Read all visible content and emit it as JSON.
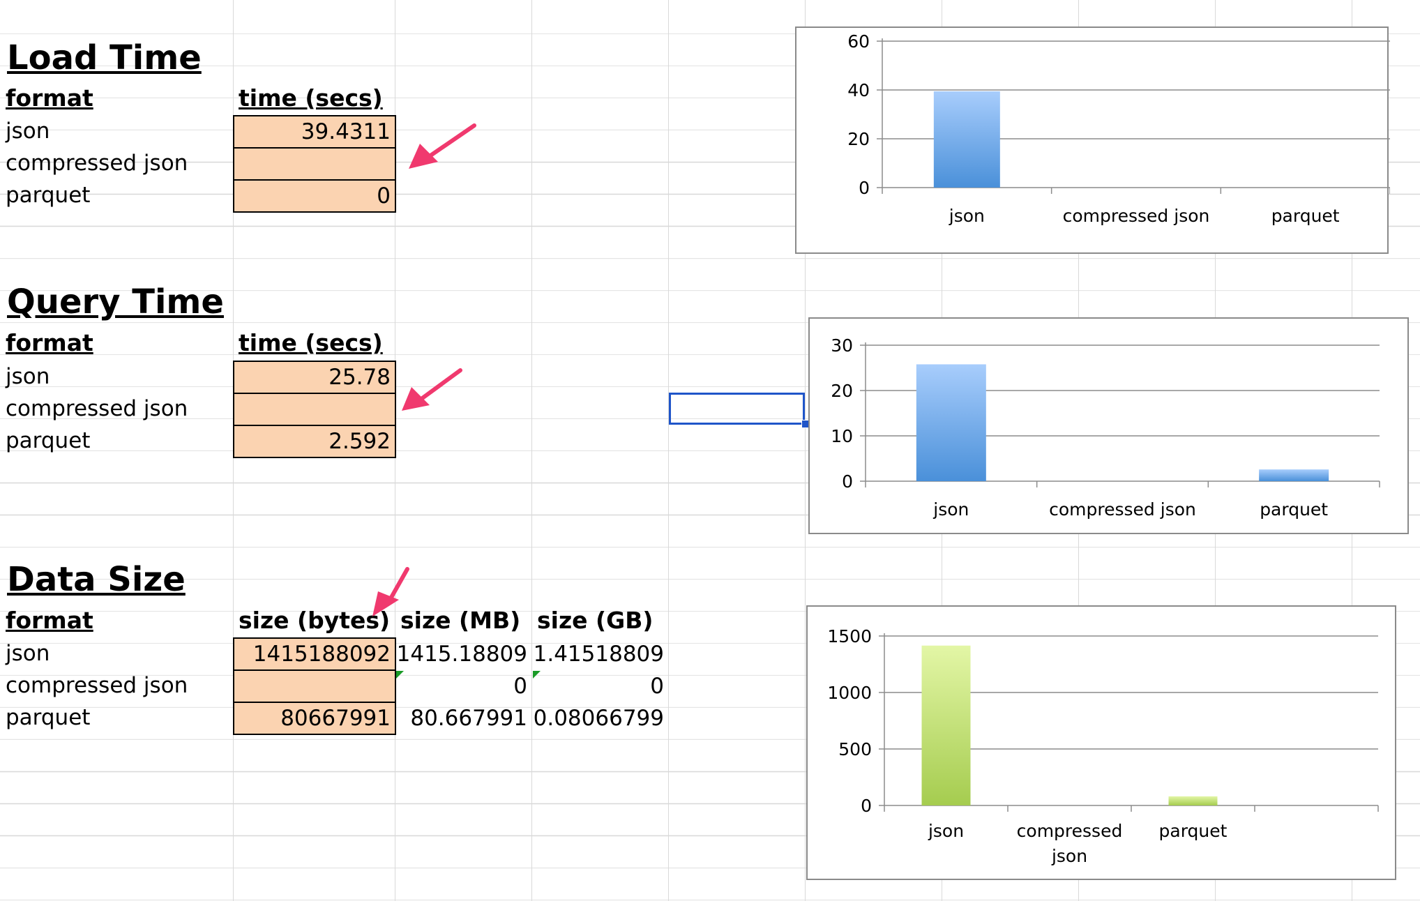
{
  "load_time": {
    "title": "Load Time",
    "headers": {
      "format": "format",
      "time": "time (secs)"
    },
    "rows": [
      {
        "format": "json",
        "time": "39.4311"
      },
      {
        "format": "compressed json",
        "time": ""
      },
      {
        "format": "parquet",
        "time": "0"
      }
    ]
  },
  "query_time": {
    "title": "Query Time",
    "headers": {
      "format": "format",
      "time": "time (secs)"
    },
    "rows": [
      {
        "format": "json",
        "time": "25.78"
      },
      {
        "format": "compressed json",
        "time": ""
      },
      {
        "format": "parquet",
        "time": "2.592"
      }
    ]
  },
  "data_size": {
    "title": "Data Size",
    "headers": {
      "format": "format",
      "bytes": "size (bytes)",
      "mb": "size (MB)",
      "gb": "size (GB)"
    },
    "rows": [
      {
        "format": "json",
        "bytes": "1415188092",
        "mb": "1415.18809",
        "gb": "1.41518809"
      },
      {
        "format": "compressed json",
        "bytes": "",
        "mb": "0",
        "gb": "0"
      },
      {
        "format": "parquet",
        "bytes": "80667991",
        "mb": "80.667991",
        "gb": "0.08066799"
      }
    ]
  },
  "colors": {
    "input_cell": "#fbd3b1",
    "arrow": "#f0396e",
    "blue_bar_top": "#a8cdfc",
    "blue_bar_bottom": "#4a90d9",
    "green_bar_top": "#e3f6a6",
    "green_bar_bottom": "#a5cc4f",
    "selection": "#1f55c9"
  },
  "chart_data": [
    {
      "type": "bar",
      "categories": [
        "json",
        "compressed json",
        "parquet"
      ],
      "values": [
        39.4311,
        0,
        0
      ],
      "yticks": [
        "0",
        "20",
        "40",
        "60"
      ],
      "ylim": [
        0,
        60
      ],
      "title": "",
      "xlabel": "",
      "ylabel": "",
      "grid": true,
      "legend": "none"
    },
    {
      "type": "bar",
      "categories": [
        "json",
        "compressed json",
        "parquet"
      ],
      "values": [
        25.78,
        0,
        2.592
      ],
      "yticks": [
        "0",
        "10",
        "20",
        "30"
      ],
      "ylim": [
        0,
        30
      ],
      "title": "",
      "xlabel": "",
      "ylabel": "",
      "grid": true,
      "legend": "none"
    },
    {
      "type": "bar",
      "categories": [
        "json",
        "compressed json",
        "parquet"
      ],
      "category_lines": [
        [
          "json"
        ],
        [
          "compressed",
          "json"
        ],
        [
          "parquet"
        ]
      ],
      "values": [
        1415.18809,
        0,
        80.667991
      ],
      "yticks": [
        "0",
        "500",
        "1000",
        "1500"
      ],
      "ylim": [
        0,
        1500
      ],
      "title": "",
      "xlabel": "",
      "ylabel": "",
      "grid": true,
      "legend": "none"
    }
  ]
}
